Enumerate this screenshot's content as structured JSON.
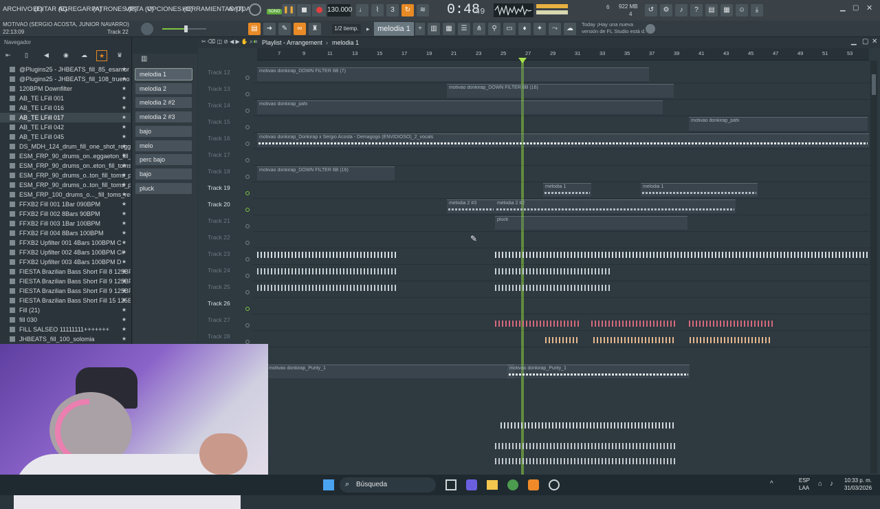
{
  "menu": [
    "ARCHIVO (F)",
    "EDITAR (E)",
    "AGREGAR (A)",
    "PATRONES (P)",
    "VISTA (V)",
    "OPCIONES (O)",
    "HERRAMIENTAS (T)",
    "AYUDA"
  ],
  "transport": {
    "tempo": "130.000",
    "time": "0:48",
    "time_sub": "49",
    "song_label": "SONG",
    "cpu": "6",
    "mem": "922 MB",
    "poly": "4"
  },
  "project": {
    "name": "MOTIVAO (SERGIO ACOSTA, JUNIOR NAVARRO)",
    "time": "22:13:09",
    "track": "Track 22"
  },
  "toolbar": {
    "snap": "1/2 tiemp.",
    "pattern": "melodia 1",
    "news_top": "Today  ¡Hay una nueva",
    "news_bottom": "versión de FL Studio está d."
  },
  "browser": {
    "title": "Navegador",
    "items": [
      "@Plugins25 - JHBEATS_fill_85_esamor",
      "@Plugins25 - JHBEATS_fill_108_trueno",
      "120BPM Downfilter",
      "AB_TE LFill 001",
      "AB_TE LFill 016",
      "AB_TE LFill 017",
      "AB_TE LFill 042",
      "AB_TE LFill 045",
      "DS_MDH_124_drum_fill_one_shot_reggae",
      "ESM_FRP_90_drums_on..eggaeton_fill_swing",
      "ESM_FRP_90_drums_on..eton_fill_toms_jack",
      "ESM_FRP_90_drums_o..ton_fill_toms_proud",
      "ESM_FRP_90_drums_o..ton_fill_toms_punch",
      "ESM_FRP_100_drums_o..._fill_toms_resonate",
      "FFXB2 Fill 001 1Bar 090BPM",
      "FFXB2 Fill 002 8Bars 90BPM",
      "FFXB2 Fill 003 1Bar 100BPM",
      "FFXB2 Fill 004 8Bars 100BPM",
      "FFXB2 Upfilter 001 4Bars 100BPM C",
      "FFXB2 Upfilter 002 4Bars 100BPM C#",
      "FFXB2 Upfilter 003 4Bars 100BPM D",
      "FIESTA Brazilian Bass Short Fill 8 125BPM",
      "FIESTA Brazilian Bass Short Fill 9 125BPM",
      "FIESTA Brazilian Bass Short Fill 9 125BPM",
      "FIESTA Brazilian Bass Short Fill 15 125BPM",
      "Fill  (21)",
      "fill 030",
      "FILL SALSEO 11111111+++++++",
      "JHBEATS_fill_100_solomia"
    ]
  },
  "patterns": [
    "melodia 1",
    "melodia 2",
    "melodia 2 #2",
    "melodia 2 #3",
    "bajo",
    "melo acompañante",
    "perc bajo",
    "bajo",
    "pluck"
  ],
  "playlist": {
    "title": "Playlist - Arrangement",
    "crumb": "melodia 1",
    "ruler": [
      "7",
      "9",
      "11",
      "13",
      "15",
      "17",
      "19",
      "21",
      "23",
      "25",
      "27",
      "29",
      "31",
      "33",
      "35",
      "37",
      "39",
      "41",
      "43",
      "45",
      "47",
      "49",
      "51",
      "53"
    ],
    "tracks": [
      "Track 12",
      "Track 13",
      "Track 14",
      "Track 15",
      "Track 16",
      "Track 17",
      "Track 18",
      "Track 19",
      "Track 20",
      "Track 21",
      "Track 22",
      "Track 23",
      "Track 24",
      "Track 25",
      "Track 26",
      "Track 27",
      "Track 28"
    ],
    "clips": [
      "motivao donkirap_DOWN FILTER 6B (7)",
      "motivao donkirap_DOWN FILTER 6B (16)",
      "motivao donkirap_pafx",
      "motivao donkirap_pafx",
      "motivao donkirap_Donkirap x Sergio Acosta - Demagogo (ENVIDIOSO)_2_vocals",
      "motivao donkirap_DOWN FILTER 6B (16)",
      "melodia 1",
      "melodia 1",
      "melodia 2 #3",
      "melodia 2 #2",
      "pluck",
      "motivao donkirap_Purity_1",
      "motivao donkirap_Purity_1"
    ]
  },
  "taskbar": {
    "search": "Búsqueda",
    "lang1": "ESP",
    "lang2": "LAA",
    "clock": "10:33 p. m.",
    "date": "31/03/2026"
  }
}
